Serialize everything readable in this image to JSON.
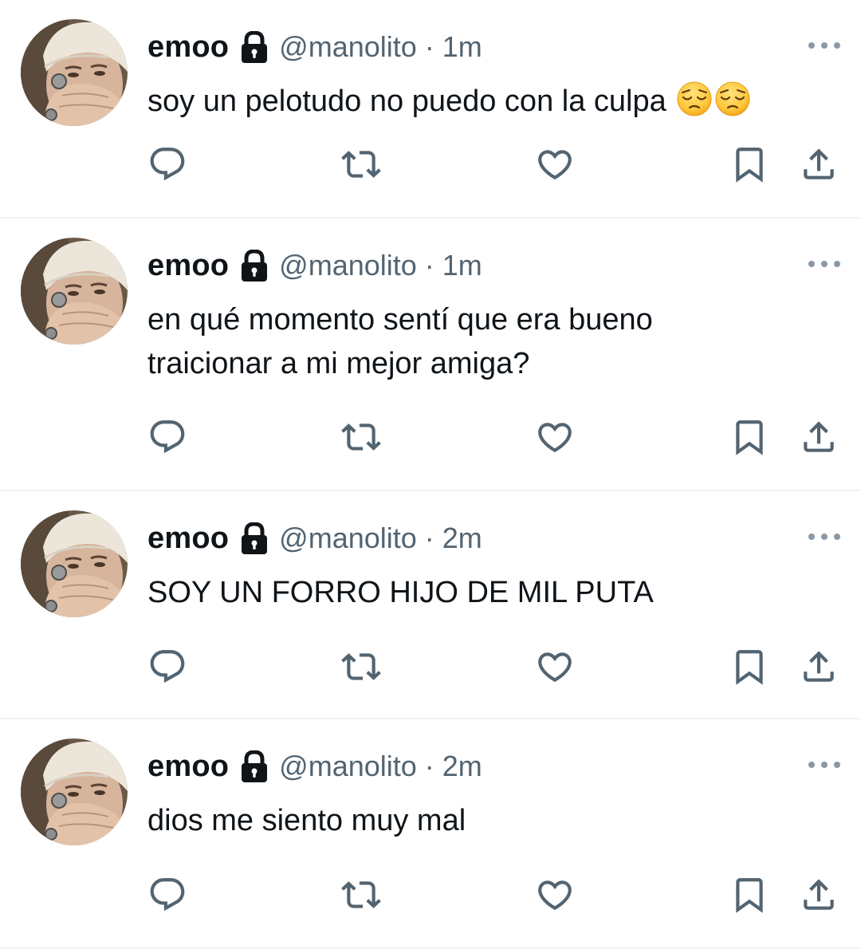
{
  "tweets": [
    {
      "name": "emoo",
      "handle": "@manolito",
      "separator": "·",
      "time": "1m",
      "text": "soy un pelotudo no puedo con la culpa",
      "emojis": [
        "pensive-face",
        "pensive-face"
      ]
    },
    {
      "name": "emoo",
      "handle": "@manolito",
      "separator": "·",
      "time": "1m",
      "text": "en qué momento sentí que era bueno\ntraicionar a mi mejor amiga?",
      "emojis": []
    },
    {
      "name": "emoo",
      "handle": "@manolito",
      "separator": "·",
      "time": "2m",
      "text": "SOY UN FORRO HIJO DE MIL PUTA",
      "emojis": []
    },
    {
      "name": "emoo",
      "handle": "@manolito",
      "separator": "·",
      "time": "2m",
      "text": "dios me siento muy mal",
      "emojis": []
    }
  ],
  "icons": {
    "protected": "lock-icon",
    "more": "more-icon",
    "reply": "reply-icon",
    "retweet": "retweet-icon",
    "like": "heart-icon",
    "bookmark": "bookmark-icon",
    "share": "share-icon"
  },
  "colors": {
    "text": "#0f1419",
    "secondary": "#536471",
    "icon": "#536471",
    "divider": "#eff3f4"
  }
}
